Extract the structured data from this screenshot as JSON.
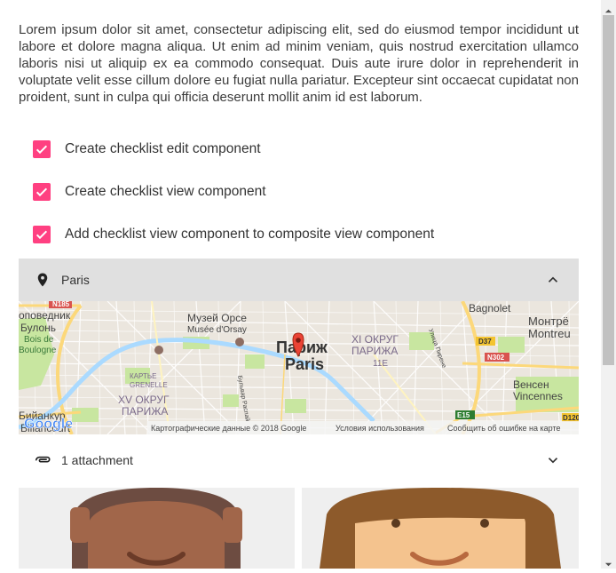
{
  "description": "Lorem ipsum dolor sit amet, consectetur adipiscing elit, sed do eiusmod tempor incididunt ut labore et dolore magna aliqua. Ut enim ad minim veniam, quis nostrud exercitation ullamco laboris nisi ut aliquip ex ea commodo consequat. Duis aute irure dolor in reprehenderit in voluptate velit esse cillum dolore eu fugiat nulla pariatur. Excepteur sint occaecat cupidatat non proident, sunt in culpa qui officia deserunt mollit anim id est laborum.",
  "checklist": [
    {
      "label": "Create checklist edit component",
      "checked": true
    },
    {
      "label": "Create checklist view component",
      "checked": true
    },
    {
      "label": "Add checklist view component to composite view component",
      "checked": true
    }
  ],
  "location": {
    "label": "Paris",
    "icon": "place-icon",
    "expanded": true
  },
  "map": {
    "labels": {
      "center_ru": "Париж",
      "center_en": "Paris",
      "museum_ru": "Музей Орсе",
      "museum_fr": "Musée d'Orsay",
      "arr11_ru": "XI ОКРУГ",
      "arr11_ru2": "ПАРИЖА",
      "arr11": "11E",
      "arr15_ru": "XV ОКРУГ",
      "arr15_ru2": "ПАРИЖА",
      "bagnolet": "Bagnolet",
      "montreuil_ru": "Монтрё",
      "montreuil": "Montreu",
      "vincennes_ru": "Венсен",
      "vincennes": "Vincennes",
      "boulogne_ru": "оповедник",
      "boulogne_ru2": "Булонь",
      "bois": "Bois de",
      "boulogne": "Boulogne",
      "billancourt_ru": "Бийанкур",
      "billancourt": "Billancourt",
      "grenelle_ru": "КАРТЬЕ",
      "grenelle": "GRENELLE",
      "road_n185": "N185",
      "road_d37": "D37",
      "road_n302": "N302",
      "road_e15": "E15",
      "road_d120": "D120",
      "street1": "Бульвар Распай",
      "street2": "Улица Пирене",
      "logo": "Google",
      "attribution": "Картографические данные © 2018 Google",
      "terms": "Условия использования",
      "report": "Сообщить об ошибке на карте"
    }
  },
  "attachments": {
    "label": "1 attachment",
    "icon": "attachment-icon",
    "expanded": false
  },
  "colors": {
    "accent": "#ff4081",
    "header_bg": "#e0e0e0",
    "river": "#aadaff",
    "park": "#c8e6a0",
    "road_major": "#fcd87a",
    "marker": "#ea4335"
  }
}
